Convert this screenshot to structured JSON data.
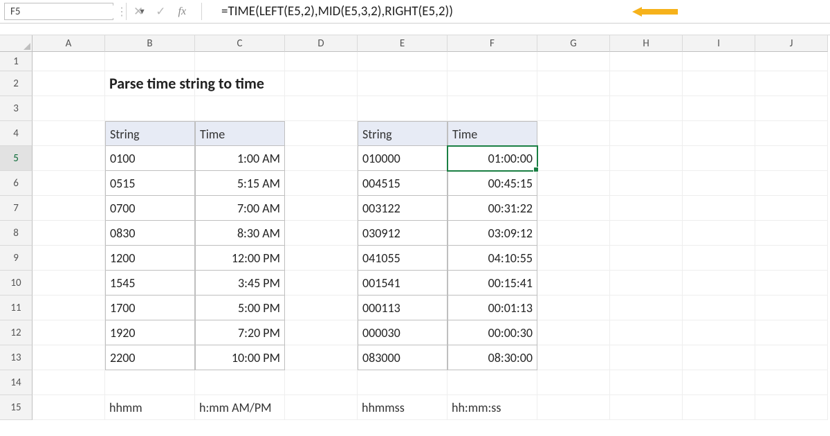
{
  "nameBox": "F5",
  "formula": "=TIME(LEFT(E5,2),MID(E5,3,2),RIGHT(E5,2))",
  "columns": [
    "A",
    "B",
    "C",
    "D",
    "E",
    "F",
    "G",
    "H",
    "I",
    "J"
  ],
  "rows": [
    "1",
    "2",
    "3",
    "4",
    "5",
    "6",
    "7",
    "8",
    "9",
    "10",
    "11",
    "12",
    "13",
    "14",
    "15"
  ],
  "title": "Parse time string to time",
  "table1": {
    "header": {
      "string": "String",
      "time": "Time"
    },
    "rows": [
      {
        "s": "0100",
        "t": "1:00 AM"
      },
      {
        "s": "0515",
        "t": "5:15 AM"
      },
      {
        "s": "0700",
        "t": "7:00 AM"
      },
      {
        "s": "0830",
        "t": "8:30 AM"
      },
      {
        "s": "1200",
        "t": "12:00 PM"
      },
      {
        "s": "1545",
        "t": "3:45 PM"
      },
      {
        "s": "1700",
        "t": "5:00 PM"
      },
      {
        "s": "1920",
        "t": "7:20 PM"
      },
      {
        "s": "2200",
        "t": "10:00 PM"
      }
    ],
    "footer": {
      "s": "hhmm",
      "t": "h:mm AM/PM"
    }
  },
  "table2": {
    "header": {
      "string": "String",
      "time": "Time"
    },
    "rows": [
      {
        "s": "010000",
        "t": "01:00:00"
      },
      {
        "s": "004515",
        "t": "00:45:15"
      },
      {
        "s": "003122",
        "t": "00:31:22"
      },
      {
        "s": "030912",
        "t": "03:09:12"
      },
      {
        "s": "041055",
        "t": "04:10:55"
      },
      {
        "s": "001541",
        "t": "00:15:41"
      },
      {
        "s": "000113",
        "t": "00:01:13"
      },
      {
        "s": "000030",
        "t": "00:00:30"
      },
      {
        "s": "083000",
        "t": "08:30:00"
      }
    ],
    "footer": {
      "s": "hhmmss",
      "t": "hh:mm:ss"
    }
  },
  "activeCell": {
    "row": 5,
    "col": "F"
  }
}
